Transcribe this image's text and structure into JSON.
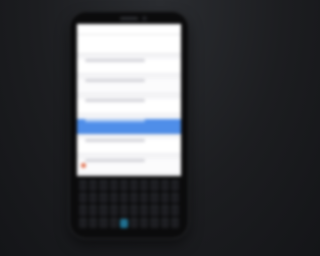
{
  "device": {
    "type": "smartphone",
    "color": "#0b0b0c",
    "screen_color": "#f4f4f6",
    "highlight_color": "#4f8ee9",
    "accent_key_color": "#1f6f8f"
  },
  "screen": {
    "rows": 9,
    "selected_row": 3
  },
  "keyboard": {
    "rows": 4,
    "columns": 10,
    "accent_key": 34
  }
}
